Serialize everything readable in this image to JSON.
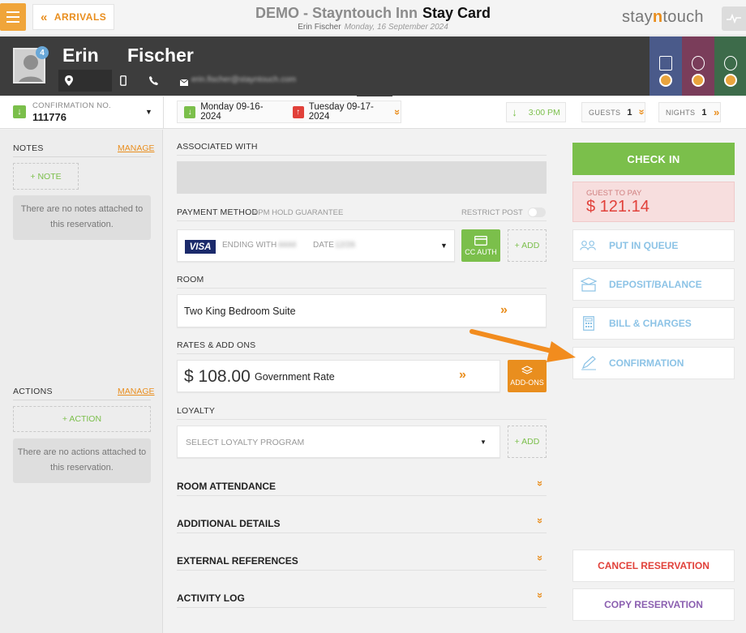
{
  "topbar": {
    "back_label": "ARRIVALS",
    "hotel_name": "DEMO - Stayntouch Inn",
    "page_title": "Stay Card",
    "guest_name": "Erin Fischer",
    "date": "Monday, 16 September 2024",
    "logo_pre": "stay",
    "logo_mid": "n",
    "logo_post": "touch"
  },
  "guest": {
    "first_name": "Erin",
    "last_name": "Fischer",
    "badge_count": "4",
    "email": "erin.fischer@stayntouch.com"
  },
  "reservation": {
    "confirmation_label": "CONFIRMATION NO.",
    "confirmation_no": "111776",
    "arrival": "Monday 09-16-2024",
    "departure": "Tuesday 09-17-2024",
    "time": "3:00 PM",
    "guests_label": "GUESTS",
    "guests": "1",
    "nights_label": "NIGHTS",
    "nights": "1"
  },
  "notes": {
    "title": "NOTES",
    "manage": "MANAGE",
    "add": "+ NOTE",
    "empty": "There are no notes attached to this reservation."
  },
  "actions": {
    "title": "ACTIONS",
    "manage": "MANAGE",
    "add": "+ ACTION",
    "empty": "There are no actions attached to this reservation."
  },
  "main": {
    "associated_label": "ASSOCIATED WITH",
    "payment_label": "PAYMENT METHOD",
    "payment_sub": "4PM HOLD GUARANTEE",
    "restrict_post": "RESTRICT POST",
    "card_brand": "VISA",
    "ending_with": "ENDING WITH",
    "ending_digits": "4444",
    "date_label": "DATE",
    "date_value": "12/26",
    "cc_auth": "CC AUTH",
    "add": "+ ADD",
    "room_label": "ROOM",
    "room_type": "Two King Bedroom Suite",
    "rates_label": "RATES & ADD ONS",
    "rate_amount": "$ 108.00",
    "rate_name": "Government Rate",
    "addons": "ADD-ONS",
    "loyalty_label": "LOYALTY",
    "loyalty_placeholder": "SELECT LOYALTY PROGRAM",
    "sections": [
      "ROOM ATTENDANCE",
      "ADDITIONAL DETAILS",
      "EXTERNAL REFERENCES",
      "ACTIVITY LOG"
    ]
  },
  "right": {
    "check_in": "CHECK IN",
    "guest_to_pay_label": "GUEST TO PAY",
    "guest_to_pay": "$ 121.14",
    "put_in_queue": "PUT IN QUEUE",
    "deposit_balance": "DEPOSIT/BALANCE",
    "bill_charges": "BILL & CHARGES",
    "confirmation": "CONFIRMATION",
    "cancel": "CANCEL RESERVATION",
    "copy": "COPY RESERVATION"
  },
  "colors": {
    "accent_orange": "#e98e1e",
    "green": "#7bbf4b",
    "red": "#e1413a",
    "light_blue": "#8cc3e6",
    "purple": "#8b5fb0"
  }
}
